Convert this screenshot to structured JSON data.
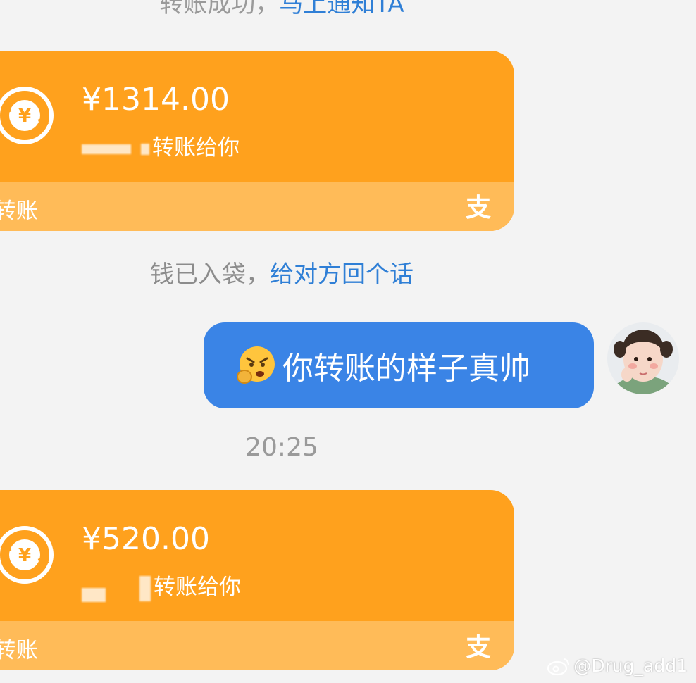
{
  "system_messages": {
    "top": {
      "text": "转账成功，",
      "link": "马上通知TA"
    },
    "middle": {
      "text": "钱已入袋，",
      "link": "给对方回个话"
    }
  },
  "transfers": [
    {
      "amount": "¥1314.00",
      "subtitle": "转账给你",
      "footer_label": "转账"
    },
    {
      "amount": "¥520.00",
      "subtitle": "转账给你",
      "footer_label": "转账"
    }
  ],
  "outgoing_message": {
    "text": "你转账的样子真帅",
    "emoji": "angry-face-emoji"
  },
  "timestamp": "20:25",
  "watermark": "@Drug_add1",
  "colors": {
    "transfer_card": "#ffa11d",
    "transfer_footer": "#ffbb58",
    "bubble": "#3a84e6",
    "link": "#2f7fd6"
  }
}
